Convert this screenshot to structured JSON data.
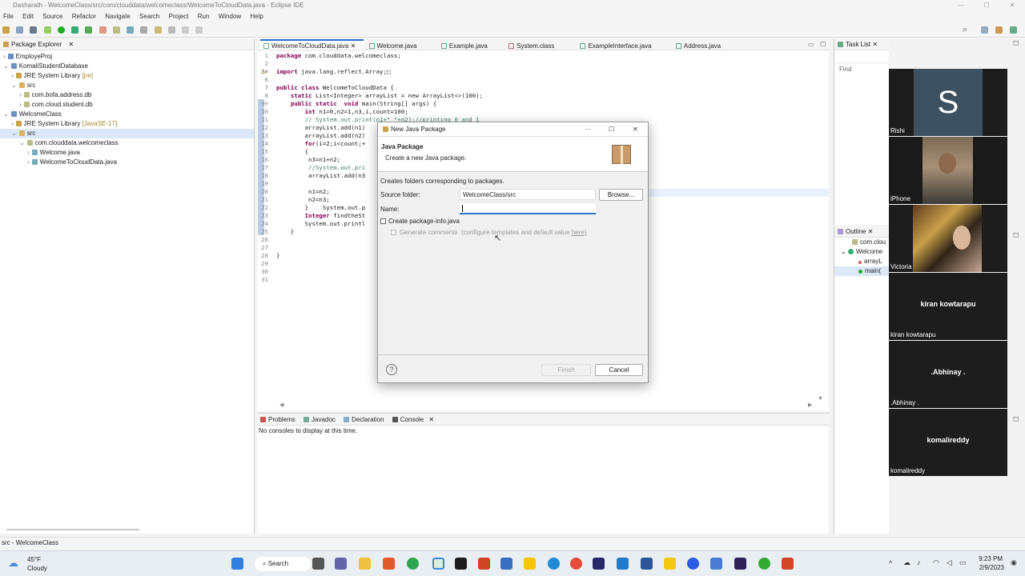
{
  "window": {
    "title": "Dasharath - WelcomeClass/src/com/clouddata/welcomeclass/WelcomeToCloudData.java - Eclipse IDE"
  },
  "menu": [
    "File",
    "Edit",
    "Source",
    "Refactor",
    "Navigate",
    "Search",
    "Project",
    "Run",
    "Window",
    "Help"
  ],
  "package_explorer": {
    "tab": "Package Explorer",
    "items": [
      {
        "label": "EmployeProj",
        "indent": 0,
        "icon": "project-icon"
      },
      {
        "label": "KomaliStudentDatabase",
        "indent": 0,
        "icon": "project-icon"
      },
      {
        "label": "JRE System Library",
        "extra": "[jre]",
        "indent": 1,
        "icon": "library-icon"
      },
      {
        "label": "src",
        "indent": 1,
        "icon": "folder-icon"
      },
      {
        "label": "com.bofa.address.db",
        "indent": 2,
        "icon": "package-icon"
      },
      {
        "label": "com.cloud.student.db",
        "indent": 2,
        "icon": "package-icon"
      },
      {
        "label": "WelcomeClass",
        "indent": 0,
        "icon": "project-icon"
      },
      {
        "label": "JRE System Library",
        "extra": "[JavaSE-17]",
        "indent": 1,
        "icon": "library-icon"
      },
      {
        "label": "src",
        "indent": 1,
        "icon": "folder-icon"
      },
      {
        "label": "com.clouddata.welcomeclass",
        "indent": 2,
        "icon": "package-icon"
      },
      {
        "label": "Welcome.java",
        "indent": 3,
        "icon": "java-file-icon"
      },
      {
        "label": "WelcomeToCloudData.java",
        "indent": 3,
        "icon": "java-file-icon"
      }
    ]
  },
  "editor": {
    "tabs": [
      "WelcomeToCloudData.java",
      "Welcome.java",
      "Example.java",
      "System.class",
      "ExampleInterface.java",
      "Address.java"
    ],
    "lines": [
      {
        "n": "1",
        "t": "package com.clouddata.welcomeclass;"
      },
      {
        "n": "2",
        "t": ""
      },
      {
        "n": "3⊕",
        "t": "import java.lang.reflect.Array;□"
      },
      {
        "n": "6",
        "t": ""
      },
      {
        "n": "7",
        "t": "public class WelcomeToCloudData {"
      },
      {
        "n": "8",
        "t": "    static List<Integer> arrayList = new ArrayList<>(100);"
      },
      {
        "n": "9⊖",
        "t": "    public static  void main(String[] args) {"
      },
      {
        "n": "10",
        "t": "        int n1=0,n2=1,n3,i,count=100;"
      },
      {
        "n": "11",
        "t": "        // System.out.print(n1+\" \"+n2);//printing 0 and 1"
      },
      {
        "n": "12",
        "t": "        arrayList.add(n1)"
      },
      {
        "n": "13",
        "t": "        arrayList.add(n2)"
      },
      {
        "n": "14",
        "t": "        for(i=2;i<count;+"
      },
      {
        "n": "15",
        "t": "        {"
      },
      {
        "n": "16",
        "t": "         n3=n1+n2;"
      },
      {
        "n": "17",
        "t": "         //System.out.pri"
      },
      {
        "n": "18",
        "t": "         arrayList.add(n3"
      },
      {
        "n": "19",
        "t": ""
      },
      {
        "n": "20",
        "t": "         n1=n2;"
      },
      {
        "n": "21",
        "t": "         n2=n3;"
      },
      {
        "n": "22",
        "t": "        }    System.out.p"
      },
      {
        "n": "23",
        "t": "        Integer findtheSt"
      },
      {
        "n": "24",
        "t": "        System.out.printl"
      },
      {
        "n": "25",
        "t": "    }"
      },
      {
        "n": "26",
        "t": ""
      },
      {
        "n": "27",
        "t": ""
      },
      {
        "n": "28",
        "t": "}"
      },
      {
        "n": "29",
        "t": ""
      },
      {
        "n": "30",
        "t": ""
      },
      {
        "n": "31",
        "t": ""
      }
    ]
  },
  "bottom_panel": {
    "tabs": [
      "Problems",
      "Javadoc",
      "Declaration",
      "Console"
    ],
    "message": "No consoles to display at this time."
  },
  "task_list": {
    "tab": "Task List",
    "find_placeholder": "Find"
  },
  "outline": {
    "tab": "Outline",
    "items": [
      "com.clou",
      "Welcome",
      "arrayL",
      "main("
    ]
  },
  "dialog": {
    "title": "New Java Package",
    "heading": "Java Package",
    "subheading": "Create a new Java package.",
    "description": "Creates folders corresponding to packages.",
    "source_label": "Source folder:",
    "source_value": "WelcomeClass/src",
    "browse": "Browse...",
    "name_label": "Name:",
    "name_value": "",
    "create_info": "Create package-info.java",
    "generate_comments": "Generate comments",
    "configure": "(configure templates and default value",
    "here": "here)",
    "finish": "Finish",
    "cancel": "Cancel"
  },
  "status_bar": {
    "text": "src - WelcomeClass"
  },
  "video_tiles": [
    {
      "label": "Rishi",
      "initial": "S",
      "type": "avatar"
    },
    {
      "label": "iPhone",
      "type": "camera"
    },
    {
      "label": "Victoria",
      "type": "camera"
    },
    {
      "label": "kiran kowtarapu",
      "center": "kiran kowtarapu",
      "type": "name"
    },
    {
      "label": ".Abhinay .",
      "center": ".Abhinay .",
      "type": "name"
    },
    {
      "label": "komalireddy",
      "center": "komalireddy",
      "type": "name"
    }
  ],
  "taskbar": {
    "weather_temp": "45°F",
    "weather_desc": "Cloudy",
    "search": "Search",
    "time": "9:23 PM",
    "date": "2/9/2023"
  },
  "colors": {
    "accent": "#2f6fc9",
    "keyword": "#7f0055",
    "comment": "#3f7f5f",
    "field": "#0000c0"
  }
}
